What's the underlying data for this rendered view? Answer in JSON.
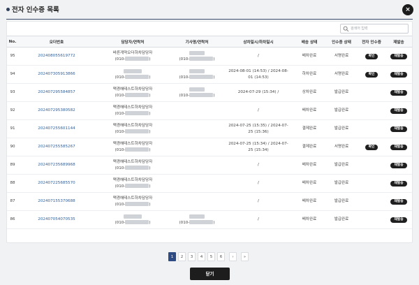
{
  "header": {
    "title": "전자 인수증 목록",
    "close_icon": "×"
  },
  "search": {
    "placeholder": "검색어 입력"
  },
  "table": {
    "columns": [
      "No.",
      "오더번호",
      "담당자/연락처",
      "기사명/연락처",
      "상차일시/하차일시",
      "배송 상태",
      "인수증 상태",
      "전자 인수증",
      "재발송"
    ],
    "rows": [
      {
        "no": "95",
        "order": "202408055619772",
        "manager": "바른게약오더하차담당자",
        "manager_phone": "(010-",
        "driver": "",
        "driver_phone": "(010-",
        "datetime1": "/",
        "datetime2": "",
        "delivery": "배차완료",
        "receipt": "서명완료",
        "confirm": "확인",
        "resend": "재발송"
      },
      {
        "no": "94",
        "order": "202407305913866",
        "manager": "",
        "manager_phone": "(010-",
        "driver": "",
        "driver_phone": "(010-",
        "datetime1": "2024-08-01 (14:53) / 2024-08-",
        "datetime2": "01 (14:53)",
        "delivery": "하차완료",
        "receipt": "서명완료",
        "confirm": "확인",
        "resend": "재발송"
      },
      {
        "no": "93",
        "order": "202407295584857",
        "manager": "맥경해테스트하차담당자",
        "manager_phone": "(010-",
        "driver": "",
        "driver_phone": "(010-",
        "datetime1": "2024-07-29 (15:34) /",
        "datetime2": "",
        "delivery": "상차완료",
        "receipt": "발급완료",
        "confirm": "",
        "resend": "재발송"
      },
      {
        "no": "92",
        "order": "202407295380582",
        "manager": "맥경해테스트하차담당자",
        "manager_phone": "(010-",
        "driver": "",
        "driver_phone": "",
        "datetime1": "/",
        "datetime2": "",
        "delivery": "배차완료",
        "receipt": "발급완료",
        "confirm": "",
        "resend": "재발송"
      },
      {
        "no": "91",
        "order": "202407255601144",
        "manager": "맥경해테스트하차담당자",
        "manager_phone": "(010-",
        "driver": "",
        "driver_phone": "",
        "datetime1": "2024-07-25 (15:35) / 2024-07-",
        "datetime2": "25 (15:36)",
        "delivery": "결제완료",
        "receipt": "발급완료",
        "confirm": "",
        "resend": "재발송"
      },
      {
        "no": "90",
        "order": "202407255585267",
        "manager": "맥경해테스트하차담당자",
        "manager_phone": "(010-",
        "driver": "",
        "driver_phone": "",
        "datetime1": "2024-07-25 (15:34) / 2024-07-",
        "datetime2": "25 (15:34)",
        "delivery": "결제완료",
        "receipt": "서명완료",
        "confirm": "확인",
        "resend": "재발송"
      },
      {
        "no": "89",
        "order": "202407235689968",
        "manager": "맥경해테스트하차담당자",
        "manager_phone": "(010-",
        "driver": "",
        "driver_phone": "",
        "datetime1": "/",
        "datetime2": "",
        "delivery": "배차완료",
        "receipt": "발급완료",
        "confirm": "",
        "resend": "재발송"
      },
      {
        "no": "88",
        "order": "202407225685570",
        "manager": "맥경해테스트하차담당자",
        "manager_phone": "(010-",
        "driver": "",
        "driver_phone": "",
        "datetime1": "/",
        "datetime2": "",
        "delivery": "배차완료",
        "receipt": "발급완료",
        "confirm": "",
        "resend": "재발송"
      },
      {
        "no": "87",
        "order": "202407155370688",
        "manager": "맥경해테스트하차담당자",
        "manager_phone": "(010-",
        "driver": "",
        "driver_phone": "",
        "datetime1": "/",
        "datetime2": "",
        "delivery": "배차완료",
        "receipt": "발급완료",
        "confirm": "",
        "resend": "재발송"
      },
      {
        "no": "86",
        "order": "202407054070535",
        "manager": "",
        "manager_phone": "(010-",
        "driver": "",
        "driver_phone": "(010-",
        "datetime1": "/",
        "datetime2": "",
        "delivery": "배차완료",
        "receipt": "발급완료",
        "confirm": "",
        "resend": "재발송"
      }
    ]
  },
  "pagination": {
    "pages": [
      "1",
      "2",
      "3",
      "4",
      "5",
      "6"
    ],
    "next": "›",
    "last": "»",
    "current": "1"
  },
  "footer": {
    "close_label": "닫기"
  },
  "colors": {
    "accent": "#2e4b84",
    "link": "#2e5f9e",
    "pill": "#1f1f1f"
  }
}
